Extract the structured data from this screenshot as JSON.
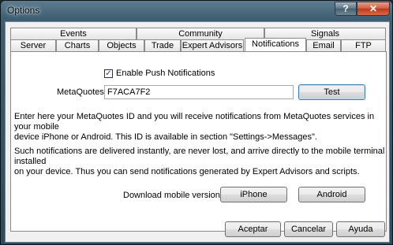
{
  "window": {
    "title": "Options",
    "help_glyph": "?",
    "close_glyph": "✕"
  },
  "tabs_row1": [
    "Events",
    "Community",
    "Signals"
  ],
  "tabs_row2": [
    "Server",
    "Charts",
    "Objects",
    "Trade",
    "Expert Advisors",
    "Notifications",
    "Email",
    "FTP"
  ],
  "active_tab": "Notifications",
  "notifications": {
    "enable_label": "Enable Push Notifications",
    "enable_checked": true,
    "check_glyph": "✓",
    "id_label": "MetaQuotes ID",
    "id_value": "F7ACA7F2",
    "test_button": "Test",
    "info1_line1": "Enter here your MetaQuotes ID and you will receive notifications from MetaQuotes services in your mobile",
    "info1_line2": "device iPhone or Android. This ID is available in section \"Settings->Messages\".",
    "info2_line1": "Such notifications are delivered instantly, are never lost, and arrive directly to the mobile terminal installed",
    "info2_line2": "on your device. Thus you can send notifications generated by Expert Advisors and scripts.",
    "download_label": "Download mobile versions for:",
    "iphone_button": "iPhone",
    "android_button": "Android"
  },
  "footer": {
    "accept_button": "Aceptar",
    "cancel_button": "Cancelar",
    "help_button": "Ayuda"
  }
}
